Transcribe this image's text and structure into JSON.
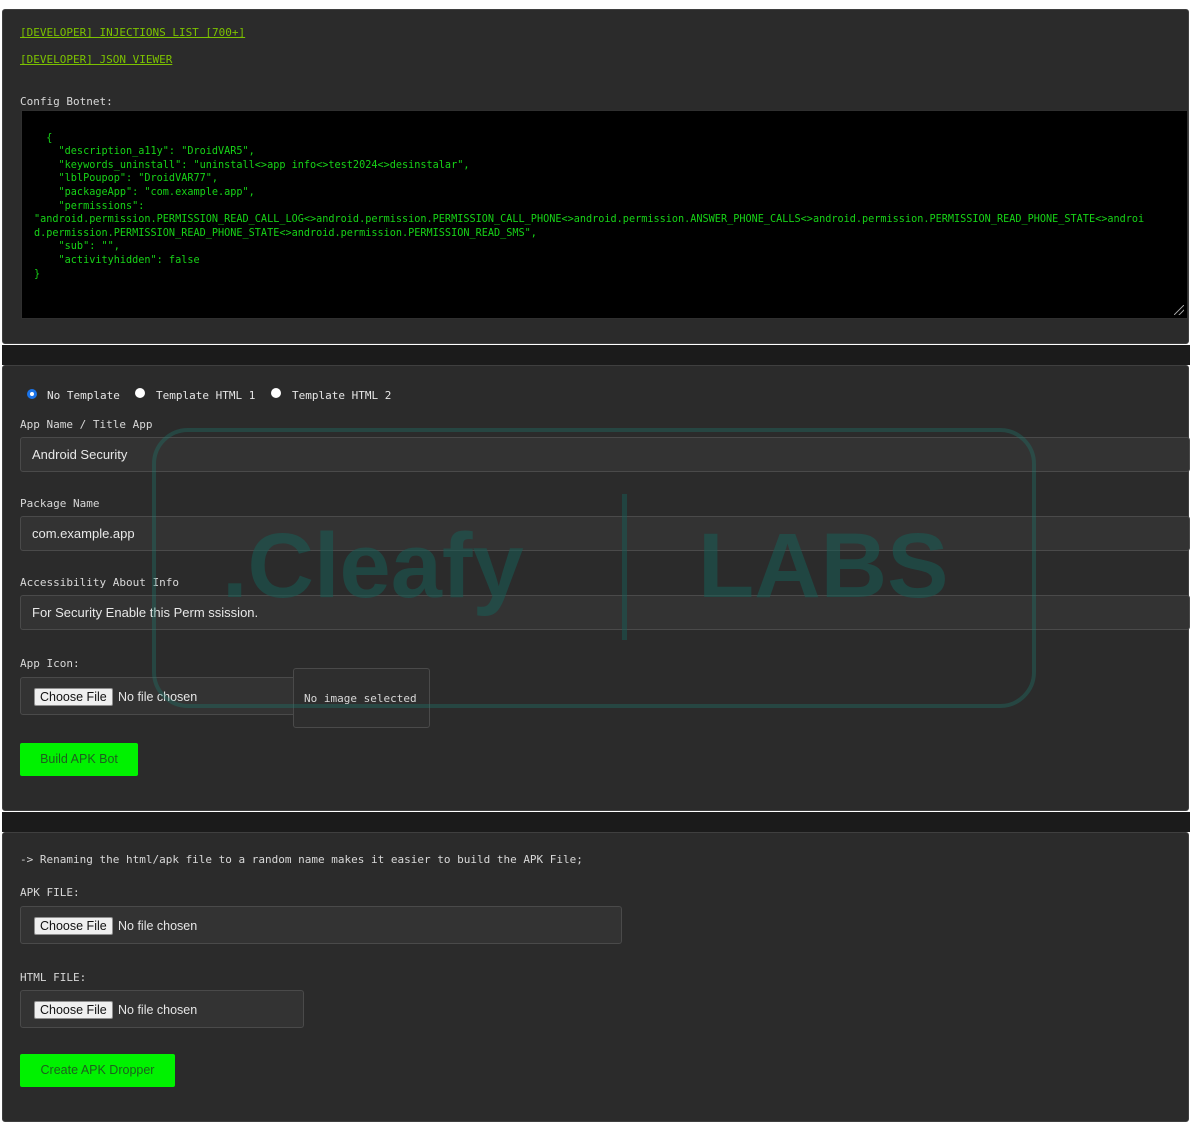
{
  "links": {
    "injections": "[DEVELOPER] INJECTIONS LIST [700+]",
    "json_viewer": "[DEVELOPER] JSON VIEWER"
  },
  "config": {
    "label": "Config Botnet:",
    "json_text": "{\n    \"description_a11y\": \"DroidVAR5\",\n    \"keywords_uninstall\": \"uninstall<>app info<>test2024<>desinstalar\",\n    \"lblPoupop\": \"DroidVAR77\",\n    \"packageApp\": \"com.example.app\",\n    \"permissions\":\n\"android.permission.PERMISSION_READ_CALL_LOG<>android.permission.PERMISSION_CALL_PHONE<>android.permission.ANSWER_PHONE_CALLS<>android.permission.PERMISSION_READ_PHONE_STATE<>androi\nd.permission.PERMISSION_READ_PHONE_STATE<>android.permission.PERMISSION_READ_SMS\",\n    \"sub\": \"\",\n    \"activityhidden\": false\n}"
  },
  "template": {
    "options": [
      "No Template",
      "Template HTML 1",
      "Template HTML 2"
    ],
    "selected": "No Template"
  },
  "form": {
    "app_name_label": "App Name / Title App",
    "app_name_value": "Android Security",
    "package_label": "Package Name",
    "package_value": "com.example.app",
    "accessibility_label": "Accessibility About Info",
    "accessibility_value": "For Security Enable this Perm ssission.",
    "icon_label": "App Icon:",
    "choose_file": "Choose File",
    "no_file": "No file chosen",
    "preview_text": "No image selected",
    "build_button": "Build APK Bot"
  },
  "dropper": {
    "note": "-> Renaming the html/apk file to a random name makes it easier to build the APK File;",
    "apk_label": "APK FILE:",
    "html_label": "HTML FILE:",
    "choose_file": "Choose File",
    "no_file": "No file chosen",
    "create_button": "Create APK Dropper"
  },
  "watermark": {
    "brand": ".Cleafy",
    "suffix": "LABS"
  },
  "colors": {
    "link": "#7cc200",
    "code_text": "#17d317",
    "button": "#00f200",
    "panel": "#2b2b2b"
  }
}
